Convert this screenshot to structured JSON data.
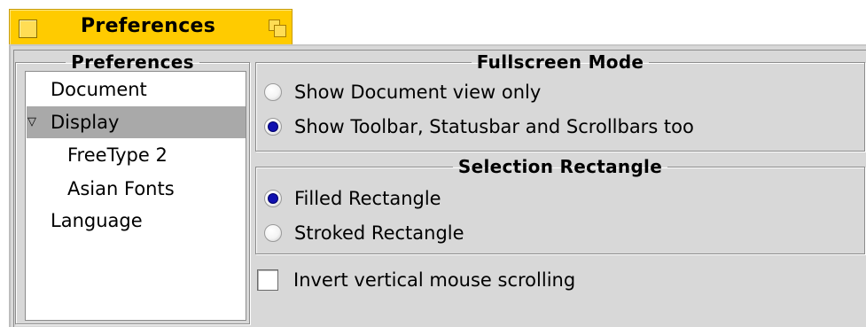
{
  "window": {
    "title": "Preferences"
  },
  "sidebar": {
    "group_label": "Preferences",
    "items": [
      {
        "label": "Document",
        "selected": false,
        "indent": 0,
        "expanded": null
      },
      {
        "label": "Display",
        "selected": true,
        "indent": 0,
        "expanded": true
      },
      {
        "label": "FreeType 2",
        "selected": false,
        "indent": 1,
        "expanded": null
      },
      {
        "label": "Asian Fonts",
        "selected": false,
        "indent": 1,
        "expanded": null
      },
      {
        "label": "Language",
        "selected": false,
        "indent": 0,
        "expanded": null
      }
    ]
  },
  "fullscreen_mode": {
    "group_label": "Fullscreen Mode",
    "options": [
      {
        "label": "Show Document view only",
        "checked": false
      },
      {
        "label": "Show Toolbar, Statusbar and Scrollbars too",
        "checked": true
      }
    ]
  },
  "selection_rectangle": {
    "group_label": "Selection Rectangle",
    "options": [
      {
        "label": "Filled Rectangle",
        "checked": true
      },
      {
        "label": "Stroked Rectangle",
        "checked": false
      }
    ]
  },
  "invert_scrolling": {
    "label": "Invert vertical mouse scrolling",
    "checked": false
  },
  "colors": {
    "tab_accent": "#ffcb00",
    "radio_selected": "#1010b0",
    "list_selection": "#a9a9a9",
    "panel_background": "#d8d8d8"
  }
}
